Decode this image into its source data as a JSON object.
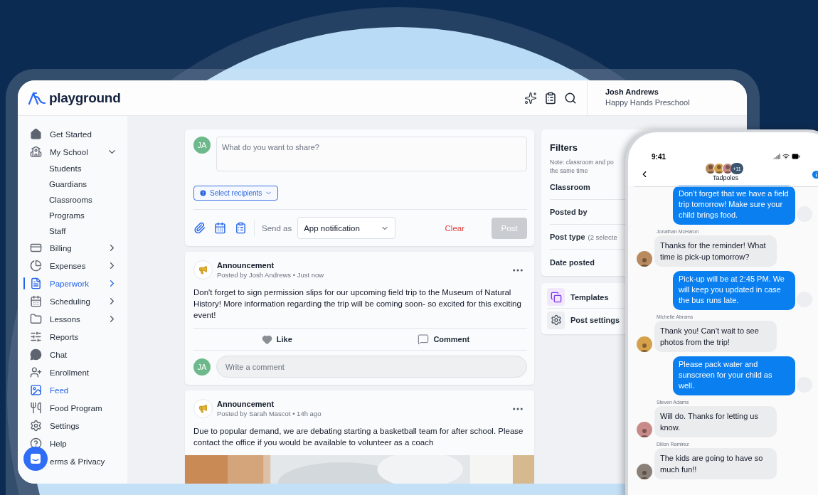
{
  "header": {
    "logo": "playground",
    "user_name": "Josh Andrews",
    "school": "Happy Hands Preschool"
  },
  "sidebar": {
    "items": [
      {
        "kind": "link",
        "label": "Get Started",
        "selected": false,
        "focused": false
      },
      {
        "kind": "group",
        "label": "My School",
        "selected": false,
        "focused": false,
        "expanded": true,
        "children": [
          {
            "label": "Students"
          },
          {
            "label": "Guardians"
          },
          {
            "label": "Classrooms"
          },
          {
            "label": "Programs"
          },
          {
            "label": "Staff"
          }
        ]
      },
      {
        "kind": "group",
        "label": "Billing",
        "selected": false,
        "focused": false,
        "expanded": false
      },
      {
        "kind": "group",
        "label": "Expenses",
        "selected": false,
        "focused": false,
        "expanded": false
      },
      {
        "kind": "group",
        "label": "Paperwork",
        "selected": true,
        "focused": true,
        "expanded": false
      },
      {
        "kind": "group",
        "label": "Scheduling",
        "selected": false,
        "focused": false,
        "expanded": false
      },
      {
        "kind": "group",
        "label": "Lessons",
        "selected": false,
        "focused": false,
        "expanded": false
      },
      {
        "kind": "link",
        "label": "Reports",
        "selected": false,
        "focused": false
      },
      {
        "kind": "link",
        "label": "Chat",
        "selected": false,
        "focused": false
      },
      {
        "kind": "link",
        "label": "Enrollment",
        "selected": false,
        "focused": false
      },
      {
        "kind": "link",
        "label": "Feed",
        "selected": true,
        "focused": false
      },
      {
        "kind": "link",
        "label": "Food Program",
        "selected": false,
        "focused": false
      },
      {
        "kind": "link",
        "label": "Settings",
        "selected": false,
        "focused": false
      },
      {
        "kind": "link",
        "label": "Help",
        "selected": false,
        "focused": false
      },
      {
        "kind": "link",
        "label": "erms & Privacy",
        "selected": false,
        "focused": false
      }
    ]
  },
  "composer": {
    "avatar": "JA",
    "placeholder": "What do you want to share?",
    "recipients": "Select recipients",
    "send_as_label": "Send as",
    "send_as_value": "App notification",
    "clear": "Clear",
    "post": {
      "label": "Post",
      "disabled": true
    }
  },
  "posts": [
    {
      "title": "Announcement",
      "meta": "Posted by Josh Andrews • Just now",
      "body": "Don't forget to sign permission slips for our upcoming field trip to the Museum of Natural History! More information regarding the trip will be coming soon- so excited for this exciting event!",
      "like": "Like",
      "comment": "Comment",
      "comment_avatar": "JA",
      "comment_placeholder": "Write a comment"
    },
    {
      "title": "Announcement",
      "meta": "Posted by Sarah Mascot • 14h ago",
      "body": "Due to popular demand, we are debating starting a basketball team for after school. Please contact the office if you would be available to volunteer as a coach"
    }
  ],
  "filters": {
    "title": "Filters",
    "note_lines": [
      "Note: classroom and po",
      "the same time"
    ],
    "rows": [
      {
        "label": "Classroom"
      },
      {
        "label": "Posted by"
      },
      {
        "label": "Post type",
        "detail": "(2 selecte"
      },
      {
        "label": "Date posted"
      }
    ]
  },
  "tools": [
    {
      "label": "Templates"
    },
    {
      "label": "Post settings"
    }
  ],
  "phone": {
    "time": "9:41",
    "group": "Tadpoles",
    "member_count": "+11",
    "messages": [
      {
        "kind": "sent",
        "text": "Don’t forget that we have a field trip tomorrow! Make sure your child brings food."
      },
      {
        "kind": "received",
        "sender": "Jonathan McHaron",
        "text": "Thanks for the reminder! What time is pick-up tomorrow?"
      },
      {
        "kind": "sent",
        "text": "Pick-up will be at 2:45 PM. We will keep you updated in case the bus runs late."
      },
      {
        "kind": "received",
        "sender": "Michelle Abrams",
        "text": "Thank you! Can’t wait to see photos from the trip!"
      },
      {
        "kind": "sent",
        "text": "Please pack water and sunscreen for your child as well."
      },
      {
        "kind": "received",
        "sender": "Steven Adams",
        "text": "Will do. Thanks for letting us know."
      },
      {
        "kind": "received",
        "sender": "Dillon Ramirez",
        "text": "The kids are going to have so much fun!!"
      }
    ]
  }
}
